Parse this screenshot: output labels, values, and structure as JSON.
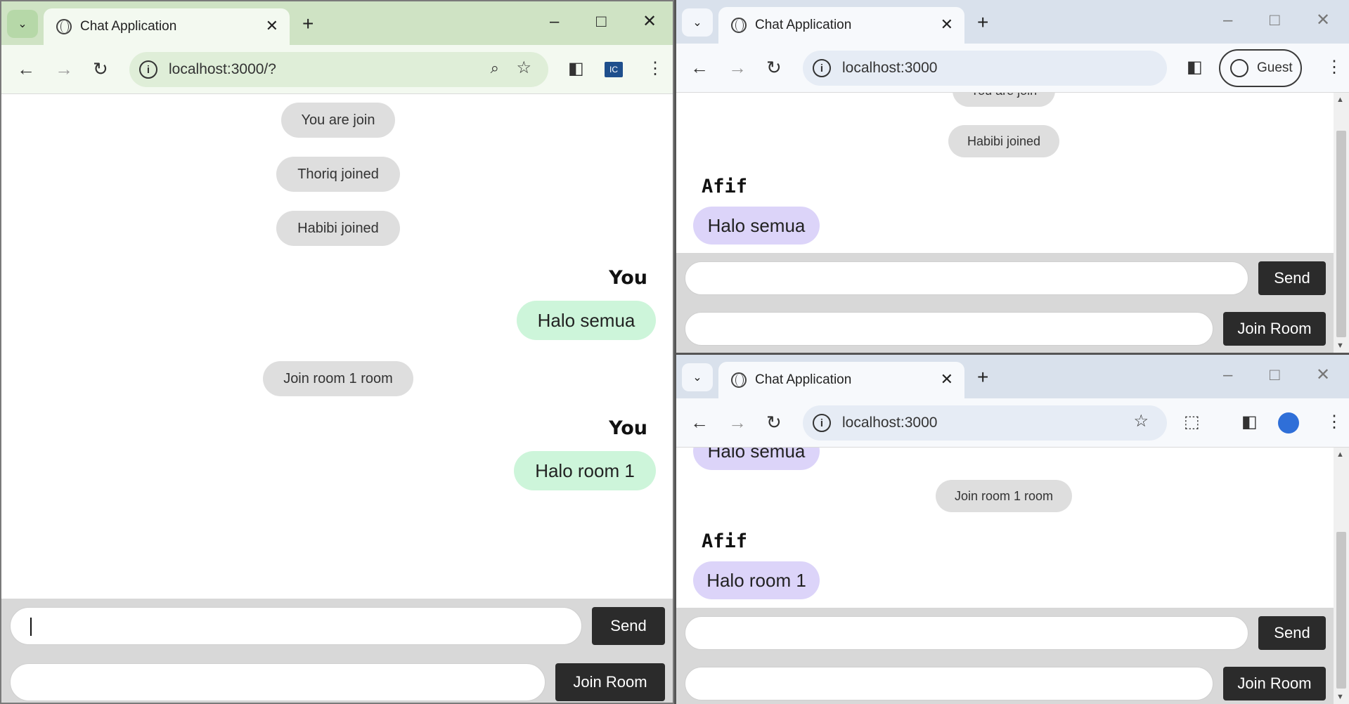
{
  "left_window": {
    "tab_title": "Chat Application",
    "url": "localhost:3000/?",
    "messages": {
      "sys1": "You are join",
      "sys2": "Thoriq joined",
      "sys3": "Habibi joined",
      "you1": "You",
      "msg1": "Halo semua",
      "sys4": "Join room 1 room",
      "you2": "You",
      "msg2": "Halo room 1"
    },
    "send_label": "Send",
    "join_label": "Join Room",
    "message_input_value": "",
    "room_input_value": ""
  },
  "top_right_window": {
    "tab_title": "Chat Application",
    "url": "localhost:3000",
    "guest_label": "Guest",
    "messages": {
      "sys_partial": "You are join",
      "sys1": "Habibi joined",
      "sender": "Afif",
      "msg1": "Halo semua"
    },
    "send_label": "Send",
    "join_label": "Join Room"
  },
  "bottom_right_window": {
    "tab_title": "Chat Application",
    "url": "localhost:3000",
    "messages": {
      "msg_partial": "Halo semua",
      "sys1": "Join room 1 room",
      "sender": "Afif",
      "msg1": "Halo room 1"
    },
    "send_label": "Send",
    "join_label": "Join Room"
  },
  "colors": {
    "own_bubble": "#cdf5da",
    "other_bubble": "#dcd4f9",
    "system_pill": "#dedede",
    "button_dark": "#2b2b2b",
    "theme_green": "#cfe3c4",
    "theme_blue": "#d9e1ec"
  }
}
